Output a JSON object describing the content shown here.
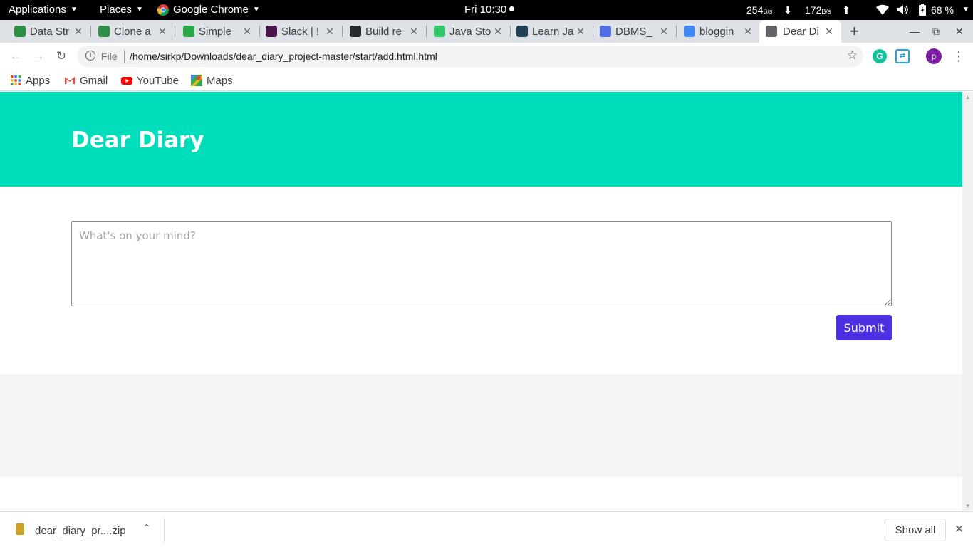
{
  "system_bar": {
    "applications": "Applications",
    "places": "Places",
    "chrome": "Google Chrome",
    "clock": "Fri 10:30",
    "download_rate": "254",
    "download_unit": "B/s",
    "upload_rate": "172",
    "upload_unit": "B/s",
    "battery": "68 %"
  },
  "tabs": [
    {
      "title": "Data Str",
      "favicon": "gfg-icon",
      "color": "#2f8d46"
    },
    {
      "title": "Clone a",
      "favicon": "gfg-icon",
      "color": "#2f8d46"
    },
    {
      "title": "Simple ",
      "favicon": "leaf-icon",
      "color": "#28a745"
    },
    {
      "title": "Slack | !",
      "favicon": "slack-icon",
      "color": "#4a154b"
    },
    {
      "title": "Build re",
      "favicon": "github-icon",
      "color": "#24292e"
    },
    {
      "title": "Java Sto",
      "favicon": "hackerrank-icon",
      "color": "#2ec866"
    },
    {
      "title": "Learn Ja",
      "favicon": "codecademy-icon",
      "color": "#1f4056"
    },
    {
      "title": "DBMS_",
      "favicon": "docs-icon",
      "color": "#4f6fe0"
    },
    {
      "title": "bloggin",
      "favicon": "google-icon",
      "color": "#4285f4"
    },
    {
      "title": "Dear Di",
      "favicon": "globe-icon",
      "color": "#5f6368",
      "active": true
    }
  ],
  "address_bar": {
    "scheme": "File",
    "url": "/home/sirkp/Downloads/dear_diary_project-master/start/add.html.html",
    "profile_initial": "p"
  },
  "bookmarks": [
    {
      "label": "Apps",
      "icon": "apps-grid-icon"
    },
    {
      "label": "Gmail",
      "icon": "gmail-icon"
    },
    {
      "label": "YouTube",
      "icon": "youtube-icon"
    },
    {
      "label": "Maps",
      "icon": "maps-icon"
    }
  ],
  "page": {
    "heading": "Dear Diary",
    "textarea_placeholder": "What's on your mind?",
    "submit_label": "Submit",
    "hero_color": "#00ddba",
    "button_color": "#4c2fe0"
  },
  "download_shelf": {
    "filename": "dear_diary_pr....zip",
    "show_all": "Show all"
  }
}
